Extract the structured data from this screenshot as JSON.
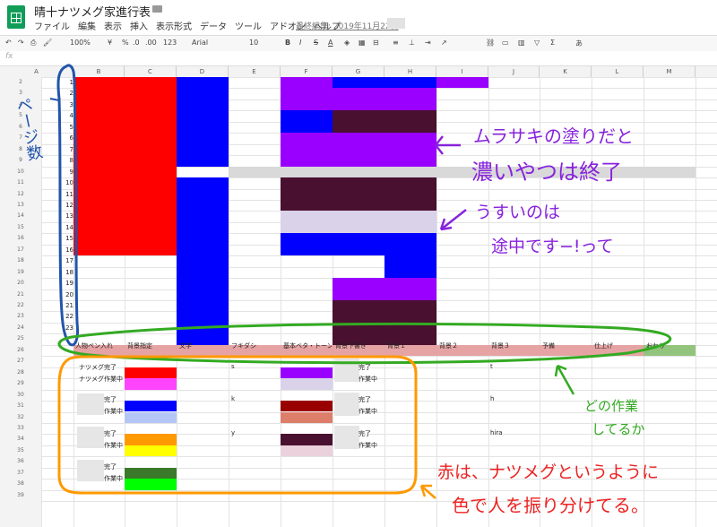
{
  "window": {
    "doc_title": "晴十ナツメグ家進行表",
    "last_edit": "最終編集: 2019年11月22日"
  },
  "menu": [
    "ファイル",
    "編集",
    "表示",
    "挿入",
    "表示形式",
    "データ",
    "ツール",
    "アドオン",
    "ヘルプ"
  ],
  "toolbar": {
    "zoom": "100%",
    "currency": "¥",
    "percent": "%",
    "dec0": ".0",
    "dec00": ".00",
    "format": "123",
    "font": "Arial",
    "size": "10",
    "bold": "B",
    "italic": "I",
    "strike": "S",
    "textcolor": "A",
    "input": "あ"
  },
  "formula_bar": {
    "fx": "fx"
  },
  "columns": [
    "A",
    "B",
    "C",
    "D",
    "E",
    "F",
    "G",
    "H",
    "I",
    "J",
    "K",
    "L",
    "M"
  ],
  "rows": [
    "2",
    "3",
    "4",
    "5",
    "6",
    "7",
    "8",
    "9",
    "10",
    "11",
    "12",
    "13",
    "14",
    "15",
    "16",
    "17",
    "18",
    "19",
    "20",
    "21",
    "22",
    "23",
    "24",
    "25",
    "26",
    "27",
    "28",
    "29",
    "30",
    "31",
    "32",
    "33",
    "34",
    "35",
    "36",
    "37",
    "38",
    "39"
  ],
  "page_numbers": [
    "1",
    "2",
    "3",
    "4",
    "5",
    "6",
    "7",
    "8",
    "9",
    "10",
    "11",
    "12",
    "13",
    "14",
    "15",
    "16",
    "17",
    "18",
    "19",
    "20",
    "21",
    "22",
    "23"
  ],
  "task_headers": [
    "人物ペン入れ",
    "背景指定",
    "文字",
    "フキダシ",
    "基本ベタ・トーン",
    "背景下書き",
    "背景１",
    "背景２",
    "背景３",
    "予備",
    "仕上げ",
    "おわり"
  ],
  "legend": {
    "natsumeg_done": "ナツメグ完了",
    "natsumeg_wip": "ナツメグ作業中",
    "s": "s",
    "k": "k",
    "y": "y",
    "t": "t",
    "h": "h",
    "hira": "hira",
    "done_suffix": "完了",
    "wip_suffix": "作業中",
    "done_suffix_2": "完了",
    "wip_suffix_2": "作業中",
    "done_suffix_3": "完了",
    "wip_suffix_3": "作業中",
    "done_suffix_4": "完了",
    "wip_suffix_4": "作業中",
    "done_suffix_5": "完了",
    "wip_suffix_5": "作業中",
    "done_suffix_6": "完了",
    "wip_suffix_6": "作業中",
    "done_suffix_7": "完了",
    "wip_suffix_7": "作業中"
  },
  "annotations": {
    "page_count": "ページ数",
    "purple_line1": "ムラサキの塗りだと",
    "purple_line2": "濃いやつは終了",
    "light_line1": "うすいのは",
    "light_line2": "途中です−!って",
    "task_line1": "どの作業",
    "task_line2": "してるか",
    "person_line1": "赤は、ナツメグというように",
    "person_line2": "色で人を振り分けてる。"
  },
  "colors": {
    "red": "#ff0000",
    "blue": "#0000ff",
    "purple": "#9900ff",
    "dark_maroon": "#4a1030",
    "light_lavender": "#d9d2e9",
    "gray": "#d9d9d9",
    "header_pink": "#e6a3a3",
    "header_green": "#93c47d",
    "annot_blue": "#2255aa",
    "annot_purple": "#8822dd",
    "annot_green": "#33aa22",
    "annot_orange": "#ff9900",
    "annot_red": "#ee2222"
  }
}
